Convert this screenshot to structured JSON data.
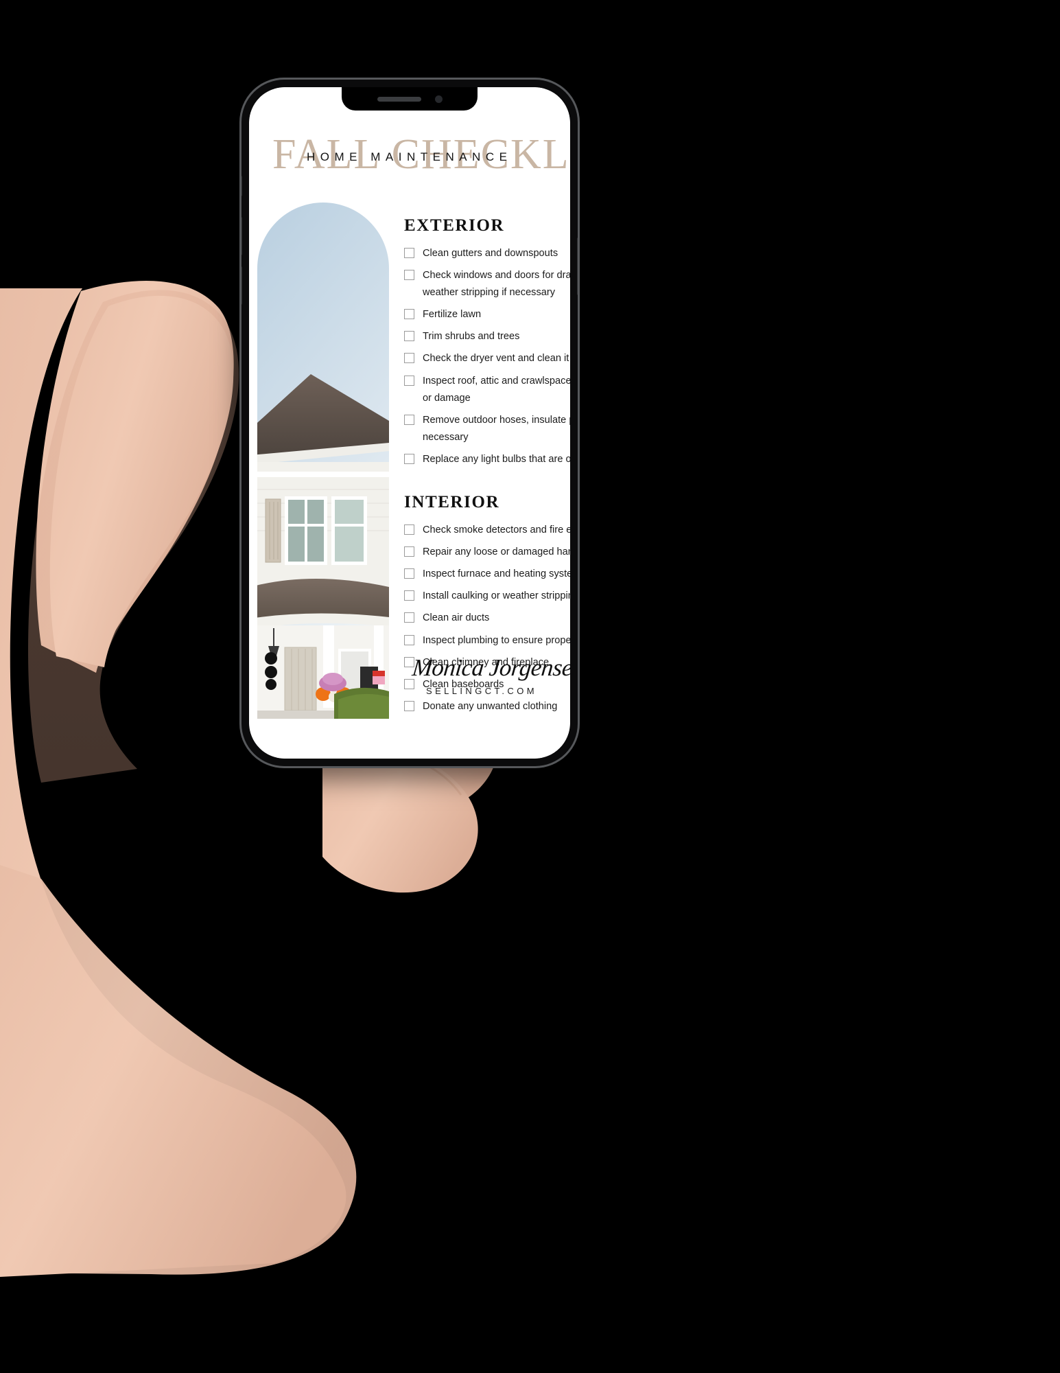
{
  "document": {
    "title_script": "FALL CHECKLIST",
    "title_overlay": "HOME MAINTENANCE",
    "sections": [
      {
        "heading": "EXTERIOR",
        "items": [
          {
            "line1": "Clean gutters and downspouts",
            "line2": ""
          },
          {
            "line1": "Check windows and doors for drafts, replace",
            "line2": "weather stripping if necessary"
          },
          {
            "line1": "Fertilize lawn",
            "line2": ""
          },
          {
            "line1": "Trim shrubs and trees",
            "line2": ""
          },
          {
            "line1": "Check the dryer vent and clean it out",
            "line2": ""
          },
          {
            "line1": "Inspect roof, attic and crawlspace for leaks",
            "line2": "or damage"
          },
          {
            "line1": "Remove outdoor hoses, insulate pipes if",
            "line2": "necessary"
          },
          {
            "line1": "Replace any light bulbs that are out",
            "line2": ""
          }
        ]
      },
      {
        "heading": "INTERIOR",
        "items": [
          {
            "line1": "Check smoke detectors and fire extinguishers",
            "line2": ""
          },
          {
            "line1": "Repair any loose or damaged handrails",
            "line2": ""
          },
          {
            "line1": "Inspect furnace and heating system",
            "line2": ""
          },
          {
            "line1": "Install caulking or weather stripping",
            "line2": ""
          },
          {
            "line1": "Clean air ducts",
            "line2": ""
          },
          {
            "line1": "Inspect plumbing to ensure proper function",
            "line2": ""
          },
          {
            "line1": "Clean chimney and fireplace",
            "line2": ""
          },
          {
            "line1": "Clean baseboards",
            "line2": ""
          },
          {
            "line1": "Donate any unwanted clothing",
            "line2": ""
          }
        ]
      }
    ],
    "signature": {
      "name": "Monica Jorgensen",
      "brand": "SELLINGCT.COM"
    }
  },
  "device": {
    "notch": {
      "speaker": "earpiece-speaker",
      "camera": "front-camera"
    },
    "buttons": [
      "mute-switch",
      "volume-up",
      "volume-down",
      "power"
    ]
  },
  "colors": {
    "accent_tan": "#c9b6a4",
    "ink": "#111111",
    "background": "#000000",
    "paper": "#ffffff",
    "checkbox_border": "#9a9a9a"
  }
}
